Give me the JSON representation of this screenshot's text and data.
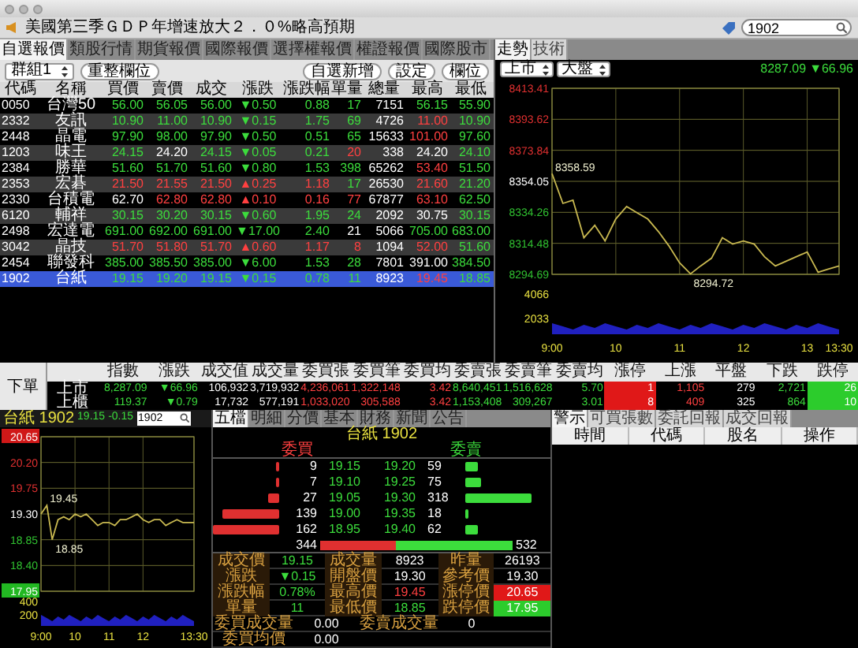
{
  "ticker": {
    "text": "美國第三季ＧＤＰ年增速放大２．０%略高預期"
  },
  "search": {
    "value": "1902"
  },
  "quote_tabs": [
    {
      "label": "自選報價",
      "selected": true
    },
    {
      "label": "類股行情",
      "selected": false
    },
    {
      "label": "期貨報價",
      "selected": false
    },
    {
      "label": "國際報價",
      "selected": false
    },
    {
      "label": "選擇權報價",
      "selected": false
    },
    {
      "label": "權證報價",
      "selected": false
    },
    {
      "label": "國際股市",
      "selected": false
    }
  ],
  "toolbar": {
    "group": "群組1",
    "buttons": [
      "重整欄位",
      "自選新增",
      "設定",
      "欄位"
    ]
  },
  "table": {
    "columns": [
      "代碼",
      "名稱",
      "買價",
      "賣價",
      "成交",
      "漲跌",
      "漲跌幅",
      "單量",
      "總量",
      "最高",
      "最低"
    ],
    "rows": [
      {
        "selected": false,
        "cells": [
          {
            "text": "0050",
            "up": false,
            "down": false
          },
          {
            "text": "台灣50",
            "up": false,
            "down": false
          },
          {
            "text": "56.00",
            "up": false,
            "down": true
          },
          {
            "text": "56.05",
            "up": false,
            "down": true
          },
          {
            "text": "56.00",
            "up": false,
            "down": true
          },
          {
            "text": "▼0.50",
            "up": false,
            "down": true
          },
          {
            "text": "0.88",
            "up": false,
            "down": true
          },
          {
            "text": "17",
            "up": false,
            "down": true
          },
          {
            "text": "7151",
            "up": false,
            "down": false
          },
          {
            "text": "56.15",
            "up": false,
            "down": true
          },
          {
            "text": "55.90",
            "up": false,
            "down": true
          }
        ]
      },
      {
        "selected": false,
        "cells": [
          {
            "text": "2332",
            "up": false,
            "down": false
          },
          {
            "text": "友訊",
            "up": false,
            "down": false
          },
          {
            "text": "10.90",
            "up": false,
            "down": true
          },
          {
            "text": "11.00",
            "up": false,
            "down": true
          },
          {
            "text": "10.90",
            "up": false,
            "down": true
          },
          {
            "text": "▼0.15",
            "up": false,
            "down": true
          },
          {
            "text": "1.75",
            "up": false,
            "down": true
          },
          {
            "text": "69",
            "up": false,
            "down": true
          },
          {
            "text": "4726",
            "up": false,
            "down": false
          },
          {
            "text": "11.00",
            "up": true,
            "down": false
          },
          {
            "text": "10.90",
            "up": false,
            "down": true
          }
        ]
      },
      {
        "selected": false,
        "cells": [
          {
            "text": "2448",
            "up": false,
            "down": false
          },
          {
            "text": "晶電",
            "up": false,
            "down": false
          },
          {
            "text": "97.90",
            "up": false,
            "down": true
          },
          {
            "text": "98.00",
            "up": false,
            "down": true
          },
          {
            "text": "97.90",
            "up": false,
            "down": true
          },
          {
            "text": "▼0.50",
            "up": false,
            "down": true
          },
          {
            "text": "0.51",
            "up": false,
            "down": true
          },
          {
            "text": "65",
            "up": false,
            "down": true
          },
          {
            "text": "15633",
            "up": false,
            "down": false
          },
          {
            "text": "101.00",
            "up": true,
            "down": false
          },
          {
            "text": "97.60",
            "up": false,
            "down": true
          }
        ]
      },
      {
        "selected": false,
        "cells": [
          {
            "text": "1203",
            "up": false,
            "down": false
          },
          {
            "text": "味王",
            "up": false,
            "down": false
          },
          {
            "text": "24.15",
            "up": false,
            "down": true
          },
          {
            "text": "24.20",
            "up": false,
            "down": false
          },
          {
            "text": "24.15",
            "up": false,
            "down": true
          },
          {
            "text": "▼0.05",
            "up": false,
            "down": true
          },
          {
            "text": "0.21",
            "up": false,
            "down": true
          },
          {
            "text": "20",
            "up": true,
            "down": false
          },
          {
            "text": "338",
            "up": false,
            "down": false
          },
          {
            "text": "24.20",
            "up": false,
            "down": false
          },
          {
            "text": "24.10",
            "up": false,
            "down": true
          }
        ]
      },
      {
        "selected": false,
        "cells": [
          {
            "text": "2384",
            "up": false,
            "down": false
          },
          {
            "text": "勝華",
            "up": false,
            "down": false
          },
          {
            "text": "51.60",
            "up": false,
            "down": true
          },
          {
            "text": "51.70",
            "up": false,
            "down": true
          },
          {
            "text": "51.60",
            "up": false,
            "down": true
          },
          {
            "text": "▼0.80",
            "up": false,
            "down": true
          },
          {
            "text": "1.53",
            "up": false,
            "down": true
          },
          {
            "text": "398",
            "up": false,
            "down": true
          },
          {
            "text": "65262",
            "up": false,
            "down": false
          },
          {
            "text": "53.40",
            "up": true,
            "down": false
          },
          {
            "text": "51.50",
            "up": false,
            "down": true
          }
        ]
      },
      {
        "selected": false,
        "cells": [
          {
            "text": "2353",
            "up": false,
            "down": false
          },
          {
            "text": "宏碁",
            "up": false,
            "down": false
          },
          {
            "text": "21.50",
            "up": true,
            "down": false
          },
          {
            "text": "21.55",
            "up": true,
            "down": false
          },
          {
            "text": "21.50",
            "up": true,
            "down": false
          },
          {
            "text": "▲0.25",
            "up": true,
            "down": false
          },
          {
            "text": "1.18",
            "up": true,
            "down": false
          },
          {
            "text": "17",
            "up": false,
            "down": true
          },
          {
            "text": "26530",
            "up": false,
            "down": false
          },
          {
            "text": "21.60",
            "up": true,
            "down": false
          },
          {
            "text": "21.20",
            "up": false,
            "down": true
          }
        ]
      },
      {
        "selected": false,
        "cells": [
          {
            "text": "2330",
            "up": false,
            "down": false
          },
          {
            "text": "台積電",
            "up": false,
            "down": false
          },
          {
            "text": "62.70",
            "up": false,
            "down": false
          },
          {
            "text": "62.80",
            "up": true,
            "down": false
          },
          {
            "text": "62.80",
            "up": true,
            "down": false
          },
          {
            "text": "▲0.10",
            "up": true,
            "down": false
          },
          {
            "text": "0.16",
            "up": true,
            "down": false
          },
          {
            "text": "77",
            "up": true,
            "down": false
          },
          {
            "text": "67877",
            "up": false,
            "down": false
          },
          {
            "text": "63.10",
            "up": true,
            "down": false
          },
          {
            "text": "62.50",
            "up": false,
            "down": true
          }
        ]
      },
      {
        "selected": false,
        "cells": [
          {
            "text": "6120",
            "up": false,
            "down": false
          },
          {
            "text": "輔祥",
            "up": false,
            "down": false
          },
          {
            "text": "30.15",
            "up": false,
            "down": true
          },
          {
            "text": "30.20",
            "up": false,
            "down": true
          },
          {
            "text": "30.15",
            "up": false,
            "down": true
          },
          {
            "text": "▼0.60",
            "up": false,
            "down": true
          },
          {
            "text": "1.95",
            "up": false,
            "down": true
          },
          {
            "text": "24",
            "up": false,
            "down": true
          },
          {
            "text": "2092",
            "up": false,
            "down": false
          },
          {
            "text": "30.75",
            "up": false,
            "down": false
          },
          {
            "text": "30.15",
            "up": false,
            "down": true
          }
        ]
      },
      {
        "selected": false,
        "cells": [
          {
            "text": "2498",
            "up": false,
            "down": false
          },
          {
            "text": "宏達電",
            "up": false,
            "down": false
          },
          {
            "text": "691.00",
            "up": false,
            "down": true
          },
          {
            "text": "692.00",
            "up": false,
            "down": true
          },
          {
            "text": "691.00",
            "up": false,
            "down": true
          },
          {
            "text": "▼17.00",
            "up": false,
            "down": true
          },
          {
            "text": "2.40",
            "up": false,
            "down": true
          },
          {
            "text": "21",
            "up": false,
            "down": false
          },
          {
            "text": "5066",
            "up": false,
            "down": false
          },
          {
            "text": "705.00",
            "up": false,
            "down": true
          },
          {
            "text": "683.00",
            "up": false,
            "down": true
          }
        ]
      },
      {
        "selected": false,
        "cells": [
          {
            "text": "3042",
            "up": false,
            "down": false
          },
          {
            "text": "晶技",
            "up": false,
            "down": false
          },
          {
            "text": "51.70",
            "up": true,
            "down": false
          },
          {
            "text": "51.80",
            "up": true,
            "down": false
          },
          {
            "text": "51.70",
            "up": true,
            "down": false
          },
          {
            "text": "▲0.60",
            "up": true,
            "down": false
          },
          {
            "text": "1.17",
            "up": true,
            "down": false
          },
          {
            "text": "8",
            "up": true,
            "down": false
          },
          {
            "text": "1094",
            "up": false,
            "down": false
          },
          {
            "text": "52.00",
            "up": true,
            "down": false
          },
          {
            "text": "51.60",
            "up": false,
            "down": true
          }
        ]
      },
      {
        "selected": false,
        "cells": [
          {
            "text": "2454",
            "up": false,
            "down": false
          },
          {
            "text": "聯發科",
            "up": false,
            "down": false
          },
          {
            "text": "385.00",
            "up": false,
            "down": true
          },
          {
            "text": "385.50",
            "up": false,
            "down": true
          },
          {
            "text": "385.00",
            "up": false,
            "down": true
          },
          {
            "text": "▼6.00",
            "up": false,
            "down": true
          },
          {
            "text": "1.53",
            "up": false,
            "down": true
          },
          {
            "text": "28",
            "up": false,
            "down": true
          },
          {
            "text": "7801",
            "up": false,
            "down": false
          },
          {
            "text": "391.00",
            "up": false,
            "down": false
          },
          {
            "text": "384.50",
            "up": false,
            "down": true
          }
        ]
      },
      {
        "selected": true,
        "cells": [
          {
            "text": "1902",
            "up": false,
            "down": false
          },
          {
            "text": "台紙",
            "up": false,
            "down": false
          },
          {
            "text": "19.15",
            "up": false,
            "down": true
          },
          {
            "text": "19.20",
            "up": false,
            "down": true
          },
          {
            "text": "19.15",
            "up": false,
            "down": true
          },
          {
            "text": "▼0.15",
            "up": false,
            "down": true
          },
          {
            "text": "0.78",
            "up": false,
            "down": true
          },
          {
            "text": "11",
            "up": false,
            "down": true
          },
          {
            "text": "8923",
            "up": false,
            "down": false
          },
          {
            "text": "19.45",
            "up": true,
            "down": false
          },
          {
            "text": "18.85",
            "up": false,
            "down": true
          }
        ]
      }
    ]
  },
  "chart_tabs": [
    {
      "label": "走勢",
      "selected": true
    },
    {
      "label": "技術",
      "selected": false
    }
  ],
  "index_chart": {
    "market": "上市",
    "index": "大盤",
    "value": "8287.09",
    "change": "▼66.96",
    "volume_ticks": [
      "4066",
      "2033"
    ],
    "chart_data": {
      "type": "line",
      "grid": true,
      "x": [
        9,
        9.17,
        9.33,
        9.5,
        9.67,
        9.83,
        10,
        10.17,
        10.33,
        10.5,
        10.67,
        10.83,
        11,
        11.17,
        11.33,
        11.5,
        11.67,
        11.83,
        12,
        12.17,
        12.33,
        12.5,
        12.67,
        12.83,
        13,
        13.17,
        13.33,
        13.5
      ],
      "series": [
        {
          "color": "#c8b850",
          "values": [
            8359,
            8340,
            8342,
            8318,
            8326,
            8316,
            8330,
            8338,
            8334,
            8330,
            8322,
            8313,
            8302,
            8295,
            8300,
            8305,
            8318,
            8314,
            8316,
            8314,
            8306,
            8300,
            8303,
            8306,
            8309,
            8296,
            8298,
            8300
          ]
        }
      ],
      "ylim": [
        8294.69,
        8413.41
      ],
      "xlim": [
        9,
        13.5
      ],
      "yticks": [
        {
          "value": 8413.41,
          "label": "8413.41"
        },
        {
          "value": 8393.62,
          "label": "8393.62"
        },
        {
          "value": 8373.84,
          "label": "8373.84"
        },
        {
          "value": 8354.05,
          "label": "8354.05"
        },
        {
          "value": 8334.26,
          "label": "8334.26"
        },
        {
          "value": 8314.48,
          "label": "8314.48"
        },
        {
          "value": 8294.69,
          "label": "8294.69"
        }
      ],
      "xticks": [
        {
          "value": 9,
          "label": "9:00"
        },
        {
          "value": 10,
          "label": "10"
        },
        {
          "value": 11,
          "label": "11"
        },
        {
          "value": 12,
          "label": "12"
        },
        {
          "value": 13,
          "label": "13"
        },
        {
          "value": 13.5,
          "label": "13:30"
        }
      ],
      "annotations": [
        {
          "x": 9,
          "y": 8358.59,
          "text": "8358.59"
        },
        {
          "x": 11.17,
          "y": 8294.72,
          "text": "8294.72"
        }
      ]
    }
  },
  "order": {
    "label": "下單"
  },
  "index_table": {
    "columns": [
      "指數",
      "漲跌",
      "成交值",
      "成交量",
      "委買張",
      "委買筆",
      "委買均",
      "委賣張",
      "委賣筆",
      "委賣均",
      "漲停",
      "上漲",
      "平盤",
      "下跌",
      "跌停"
    ],
    "rows": [
      {
        "market": "上市",
        "cells": [
          {
            "text": "8,287.09",
            "kind": "text",
            "up": false,
            "down": true
          },
          {
            "text": "▼66.96",
            "kind": "text",
            "up": false,
            "down": true
          },
          {
            "text": "106,932",
            "kind": "text",
            "up": false,
            "down": false
          },
          {
            "text": "3,719,932",
            "kind": "text",
            "up": false,
            "down": false
          },
          {
            "text": "4,236,061",
            "kind": "text",
            "up": true,
            "down": false
          },
          {
            "text": "1,322,148",
            "kind": "text",
            "up": true,
            "down": false
          },
          {
            "text": "3.42",
            "kind": "text",
            "up": true,
            "down": false
          },
          {
            "text": "8,640,451",
            "kind": "text",
            "up": false,
            "down": true
          },
          {
            "text": "1,516,628",
            "kind": "text",
            "up": false,
            "down": true
          },
          {
            "text": "5.70",
            "kind": "text",
            "up": false,
            "down": true
          },
          {
            "text": "1",
            "kind": "tag",
            "up": true,
            "down": false
          },
          {
            "text": "1,105",
            "kind": "text",
            "up": true,
            "down": false
          },
          {
            "text": "279",
            "kind": "text",
            "up": false,
            "down": false
          },
          {
            "text": "2,721",
            "kind": "text",
            "up": false,
            "down": true
          },
          {
            "text": "26",
            "kind": "tag",
            "up": false,
            "down": true
          }
        ]
      },
      {
        "market": "上櫃",
        "cells": [
          {
            "text": "119.37",
            "kind": "text",
            "up": false,
            "down": true
          },
          {
            "text": "▼0.79",
            "kind": "text",
            "up": false,
            "down": true
          },
          {
            "text": "17,732",
            "kind": "text",
            "up": false,
            "down": false
          },
          {
            "text": "577,191",
            "kind": "text",
            "up": false,
            "down": false
          },
          {
            "text": "1,033,020",
            "kind": "text",
            "up": true,
            "down": false
          },
          {
            "text": "305,588",
            "kind": "text",
            "up": true,
            "down": false
          },
          {
            "text": "3.42",
            "kind": "text",
            "up": true,
            "down": false
          },
          {
            "text": "1,153,408",
            "kind": "text",
            "up": false,
            "down": true
          },
          {
            "text": "309,267",
            "kind": "text",
            "up": false,
            "down": true
          },
          {
            "text": "3.01",
            "kind": "text",
            "up": false,
            "down": true
          },
          {
            "text": "8",
            "kind": "tag",
            "up": true,
            "down": false
          },
          {
            "text": "409",
            "kind": "text",
            "up": true,
            "down": false
          },
          {
            "text": "325",
            "kind": "text",
            "up": false,
            "down": false
          },
          {
            "text": "864",
            "kind": "text",
            "up": false,
            "down": true
          },
          {
            "text": "10",
            "kind": "tag",
            "up": false,
            "down": true
          }
        ]
      }
    ]
  },
  "stock_header": {
    "name": "台紙",
    "code": "1902",
    "price": "19.15",
    "change": "-0.15",
    "search_value": "1902"
  },
  "stock_chart": {
    "volume_ticks": [
      "400",
      "200"
    ],
    "chart_data": {
      "type": "line",
      "grid": true,
      "x": [
        9,
        9.17,
        9.33,
        9.5,
        9.67,
        9.83,
        10,
        10.17,
        10.33,
        10.5,
        10.67,
        10.83,
        11,
        11.17,
        11.33,
        11.5,
        11.67,
        11.83,
        12,
        12.17,
        12.33,
        12.5,
        12.67,
        12.83,
        13,
        13.17,
        13.33,
        13.5
      ],
      "series": [
        {
          "color": "#c8b850",
          "values": [
            19.3,
            19.45,
            18.85,
            19.2,
            19.25,
            19.2,
            19.3,
            19.25,
            19.3,
            19.2,
            19.1,
            19.15,
            19.15,
            19.1,
            19.2,
            19.2,
            19.25,
            19.3,
            19.2,
            19.15,
            19.2,
            19.2,
            19.1,
            19.15,
            19.2,
            19.15,
            19.15,
            19.15
          ]
        }
      ],
      "ylim": [
        17.95,
        20.65
      ],
      "xlim": [
        9,
        13.5
      ],
      "yticks": [
        {
          "value": 20.65,
          "label": "20.65"
        },
        {
          "value": 20.2,
          "label": "20.20"
        },
        {
          "value": 19.75,
          "label": "19.75"
        },
        {
          "value": 19.3,
          "label": "19.30"
        },
        {
          "value": 18.85,
          "label": "18.85"
        },
        {
          "value": 18.4,
          "label": "18.40"
        },
        {
          "value": 17.95,
          "label": "17.95"
        }
      ],
      "xticks": [
        {
          "value": 9,
          "label": "9:00"
        },
        {
          "value": 10,
          "label": "10"
        },
        {
          "value": 11,
          "label": "11"
        },
        {
          "value": 12,
          "label": "12"
        },
        {
          "value": 13.5,
          "label": "13:30"
        }
      ],
      "annotations": [
        {
          "x": 9.17,
          "y": 19.45,
          "text": "19.45"
        },
        {
          "x": 9.33,
          "y": 18.85,
          "text": "18.85"
        }
      ]
    }
  },
  "detail_tabs": [
    {
      "label": "五檔",
      "selected": true
    },
    {
      "label": "明細",
      "selected": false
    },
    {
      "label": "分價",
      "selected": false
    },
    {
      "label": "基本",
      "selected": false
    },
    {
      "label": "財務",
      "selected": false
    },
    {
      "label": "新聞",
      "selected": false
    },
    {
      "label": "公告",
      "selected": false
    }
  ],
  "detail_title": "台紙 1902",
  "book": {
    "bid_label": "委買",
    "ask_label": "委賣",
    "levels": [
      {
        "bid_qty": "9",
        "bid": "19.15",
        "ask": "19.20",
        "ask_qty": "59"
      },
      {
        "bid_qty": "7",
        "bid": "19.10",
        "ask": "19.25",
        "ask_qty": "75"
      },
      {
        "bid_qty": "27",
        "bid": "19.05",
        "ask": "19.30",
        "ask_qty": "318"
      },
      {
        "bid_qty": "139",
        "bid": "19.00",
        "ask": "19.35",
        "ask_qty": "18"
      },
      {
        "bid_qty": "162",
        "bid": "18.95",
        "ask": "19.40",
        "ask_qty": "62"
      }
    ],
    "bid_total": "344",
    "ask_total": "532",
    "level": 0.39
  },
  "stats": [
    [
      {
        "label": "成交價"
      },
      {
        "value": "19.15",
        "kind": "text",
        "up": false,
        "down": true
      },
      {
        "label": "成交量"
      },
      {
        "value": "8923",
        "kind": "text",
        "up": false,
        "down": false
      },
      {
        "label": "昨量"
      },
      {
        "value": "26193",
        "kind": "text",
        "up": false,
        "down": false
      }
    ],
    [
      {
        "label": "漲跌"
      },
      {
        "value": "▼0.15",
        "kind": "text",
        "up": false,
        "down": true
      },
      {
        "label": "開盤價"
      },
      {
        "value": "19.30",
        "kind": "text",
        "up": false,
        "down": false
      },
      {
        "label": "參考價"
      },
      {
        "value": "19.30",
        "kind": "text",
        "up": false,
        "down": false
      }
    ],
    [
      {
        "label": "漲跌幅"
      },
      {
        "value": "0.78%",
        "kind": "text",
        "up": false,
        "down": true
      },
      {
        "label": "最高價"
      },
      {
        "value": "19.45",
        "kind": "text",
        "up": true,
        "down": false
      },
      {
        "label": "漲停價"
      },
      {
        "value": "20.65",
        "kind": "tag",
        "up": true,
        "down": false
      }
    ],
    [
      {
        "label": "單量"
      },
      {
        "value": "11",
        "kind": "text",
        "up": false,
        "down": true
      },
      {
        "label": "最低價"
      },
      {
        "value": "18.85",
        "kind": "text",
        "up": false,
        "down": true
      },
      {
        "label": "跌停價"
      },
      {
        "value": "17.95",
        "kind": "tag",
        "up": false,
        "down": true
      }
    ]
  ],
  "totals": [
    [
      "委買成交量",
      "0.00",
      "委賣成交量",
      "0"
    ],
    [
      "委買均價",
      "0.00"
    ]
  ],
  "report_tabs": [
    {
      "label": "警示",
      "selected": true
    },
    {
      "label": "可買張數",
      "selected": false
    },
    {
      "label": "委託回報",
      "selected": false
    },
    {
      "label": "成交回報",
      "selected": false
    }
  ],
  "report_table": {
    "columns": [
      "時間",
      "代碼",
      "股名",
      "操作"
    ]
  }
}
